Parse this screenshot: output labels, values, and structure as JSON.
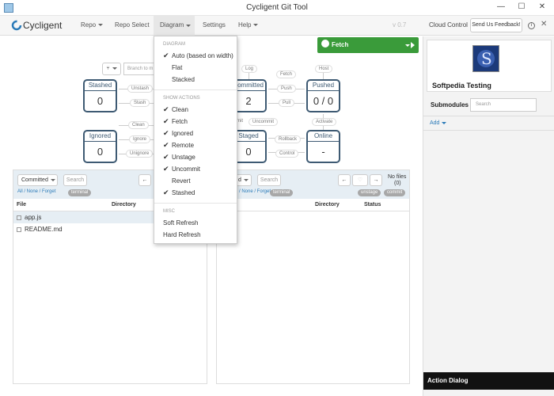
{
  "window": {
    "title": "Cycligent Git Tool",
    "min": "—",
    "max": "☐",
    "close": "✕"
  },
  "navbar": {
    "brand": "Cycligent",
    "menus": [
      "Repo",
      "Repo Select",
      "Diagram",
      "Settings",
      "Help"
    ],
    "version": "v 0.7",
    "cloud": "Cloud Control",
    "feedback": "Send Us Feedback!"
  },
  "branch": {
    "placeholder": "Branch to m"
  },
  "diagram": {
    "states": {
      "stashed": {
        "label": "Stashed",
        "value": "0"
      },
      "committed": {
        "label": "Committed",
        "value": "2"
      },
      "pushed": {
        "label": "Pushed",
        "value": "0 / 0"
      },
      "ignored": {
        "label": "Ignored",
        "value": "0"
      },
      "staged": {
        "label": "Staged",
        "value": "0"
      },
      "online": {
        "label": "Online",
        "value": "-"
      }
    },
    "actions": {
      "unstash": "Unstash",
      "stash": "Stash",
      "clean": "Clean",
      "ignore": "Ignore",
      "unignore": "Unignore",
      "log": "Log",
      "fetch": "Fetch",
      "host": "Host",
      "push": "Push",
      "pull": "Pull",
      "commit": "mit",
      "uncommit": "Uncommit",
      "activate": "Activate",
      "rollback": "Rollback",
      "control": "Control"
    },
    "fetch_button": "Fetch"
  },
  "left_panel": {
    "dropdown": "Committed",
    "search": "Search",
    "filters": "All / None / Forget",
    "tag": "terminal",
    "columns": [
      "File",
      "Directory"
    ],
    "files": [
      "app.js",
      "README.md"
    ]
  },
  "middle_panel": {
    "dropdown": "d",
    "search": "Search",
    "filters": "/ None / Forget",
    "tags": [
      "terminal",
      "unstage",
      "commit"
    ],
    "nofiles": "No files",
    "count": "(0)",
    "columns": [
      "Directory",
      "Status"
    ]
  },
  "menu": {
    "sections": {
      "diagram": "DIAGRAM",
      "actions": "SHOW ACTIONS",
      "misc": "MISC"
    },
    "diagram_items": [
      {
        "label": "Auto (based on width)",
        "checked": true
      },
      {
        "label": "Flat",
        "checked": false
      },
      {
        "label": "Stacked",
        "checked": false
      }
    ],
    "action_items": [
      {
        "label": "Clean",
        "checked": true
      },
      {
        "label": "Fetch",
        "checked": true
      },
      {
        "label": "Ignored",
        "checked": true
      },
      {
        "label": "Remote",
        "checked": true
      },
      {
        "label": "Unstage",
        "checked": true
      },
      {
        "label": "Uncommit",
        "checked": true
      },
      {
        "label": "Revert",
        "checked": false
      },
      {
        "label": "Stashed",
        "checked": true
      }
    ],
    "misc_items": [
      "Soft Refresh",
      "Hard Refresh"
    ]
  },
  "right": {
    "profile": "Softpedia Testing",
    "submodules": "Submodules",
    "search": "Search",
    "add": "Add",
    "action_dialog": "Action Dialog"
  },
  "colors": {
    "accent": "#3e5a73",
    "fetch": "#3a9b3a",
    "link": "#2a7ab8"
  }
}
